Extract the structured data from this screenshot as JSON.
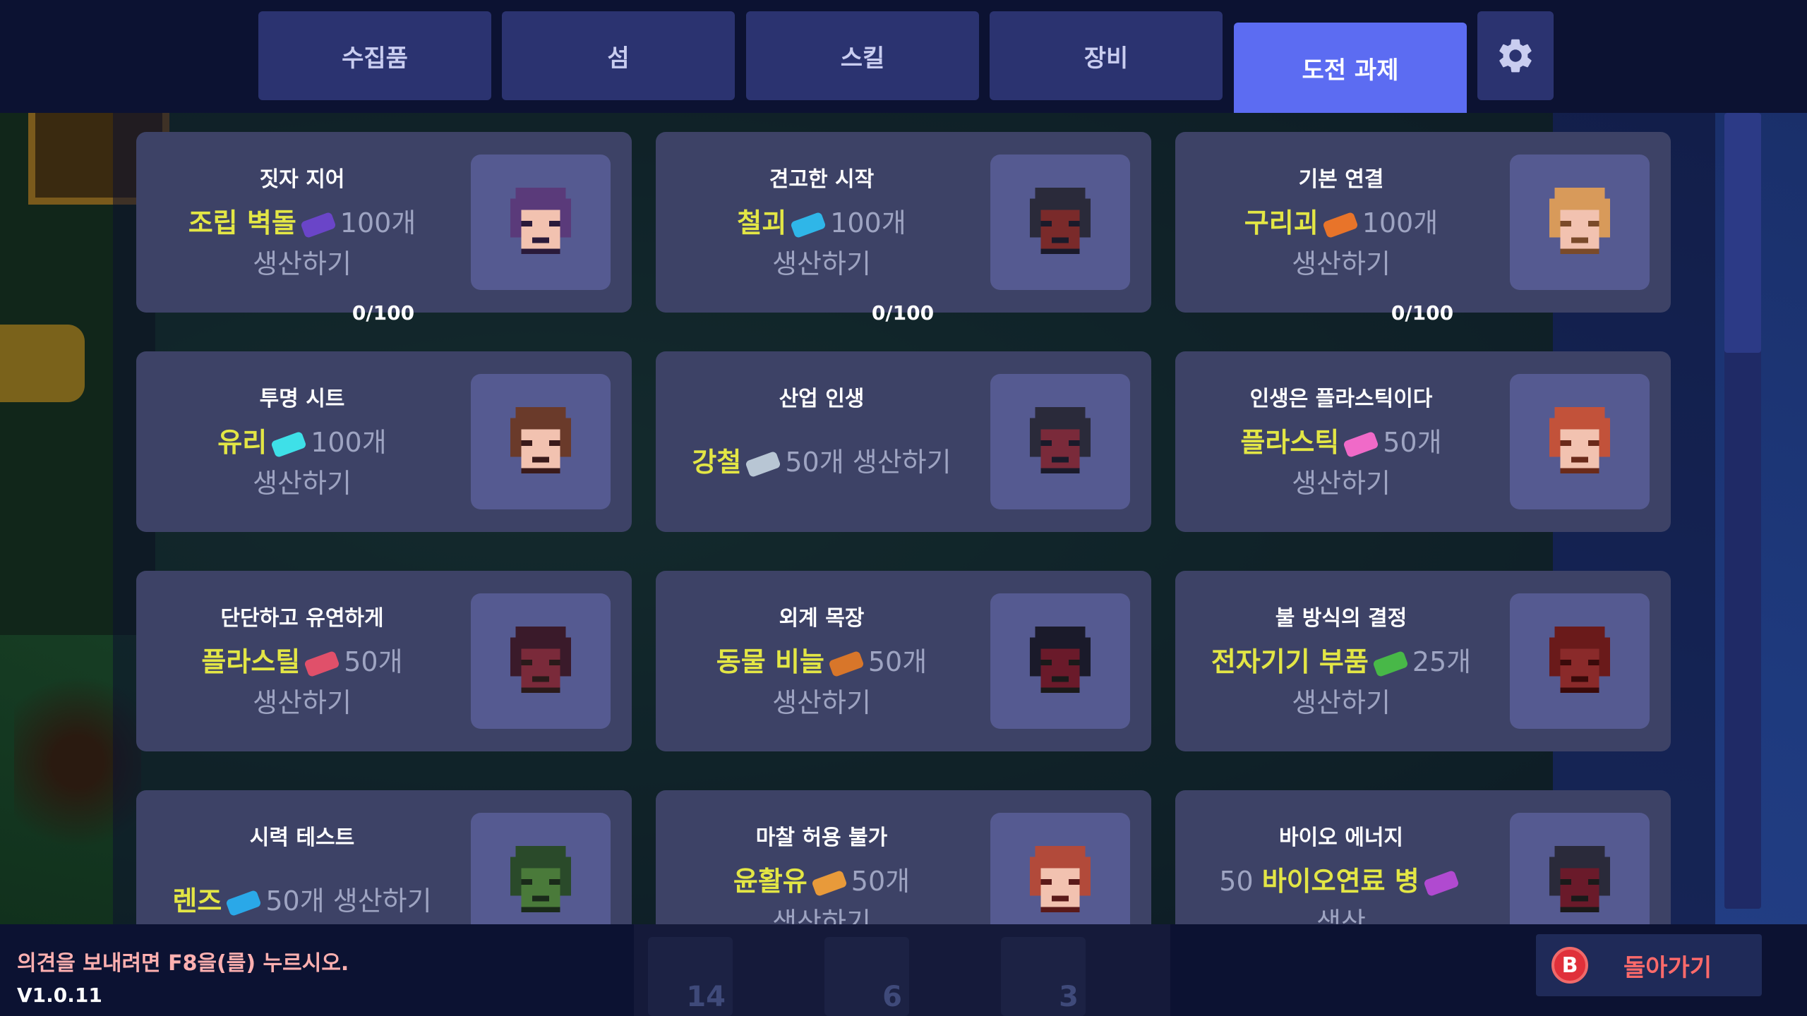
{
  "tabs": [
    {
      "label": "수집품",
      "active": false
    },
    {
      "label": "섬",
      "active": false
    },
    {
      "label": "스킬",
      "active": false
    },
    {
      "label": "장비",
      "active": false
    },
    {
      "label": "도전 과제",
      "active": true
    }
  ],
  "settings_icon": "gear-icon",
  "challenges": [
    {
      "title": "짓자 지어",
      "item": "조립 벽돌",
      "pre": "",
      "post": "100개",
      "line2": "생산하기",
      "progress": "0/100",
      "icon_color": "#6a45c8",
      "avatar": "purple-hair-face"
    },
    {
      "title": "견고한 시작",
      "item": "철괴",
      "pre": "",
      "post": "100개",
      "line2": "생산하기",
      "progress": "0/100",
      "icon_color": "#2fb6e8",
      "avatar": "dark-hair-bun-face"
    },
    {
      "title": "기본 연결",
      "item": "구리괴",
      "pre": "",
      "post": "100개",
      "line2": "생산하기",
      "progress": "0/100",
      "icon_color": "#e8742a",
      "avatar": "blonde-face"
    },
    {
      "title": "투명 시트",
      "item": "유리",
      "pre": "",
      "post": "100개",
      "line2": "생산하기",
      "progress": "",
      "icon_color": "#3ee0e8",
      "avatar": "brown-hair-face"
    },
    {
      "title": "산업 인생",
      "item": "강철",
      "pre": "",
      "post": "50개 생산하기",
      "line2": "",
      "progress": "",
      "icon_color": "#b8c6d4",
      "avatar": "dark-face"
    },
    {
      "title": "인생은 플라스틱이다",
      "item": "플라스틱",
      "pre": "",
      "post": "50개",
      "line2": "생산하기",
      "progress": "",
      "icon_color": "#f06ac8",
      "avatar": "red-hair-face"
    },
    {
      "title": "단단하고 유연하게",
      "item": "플라스틸",
      "pre": "",
      "post": "50개",
      "line2": "생산하기",
      "progress": "",
      "icon_color": "#e0506a",
      "avatar": "dark-red-face"
    },
    {
      "title": "외계 목장",
      "item": "동물 비늘",
      "pre": "",
      "post": "50개",
      "line2": "생산하기",
      "progress": "",
      "icon_color": "#d8762a",
      "avatar": "dark-curly-face"
    },
    {
      "title": "불 방식의 결정",
      "item": "전자기기 부품",
      "pre": "",
      "post": "25개",
      "line2": "생산하기",
      "progress": "",
      "icon_color": "#48b848",
      "avatar": "red-curly-face"
    },
    {
      "title": "시력 테스트",
      "item": "렌즈",
      "pre": "",
      "post": "50개 생산하기",
      "line2": "",
      "progress": "",
      "icon_color": "#2aa8e8",
      "avatar": "green-zombie-face"
    },
    {
      "title": "마찰 허용 불가",
      "item": "윤활유",
      "pre": "",
      "post": "50개",
      "line2": "생산하기",
      "progress": "",
      "icon_color": "#e89a3a",
      "avatar": "auburn-hair-face"
    },
    {
      "title": "바이오 에너지",
      "item": "바이오연료 병",
      "pre": "50",
      "post": "",
      "line2": "생산",
      "progress": "",
      "icon_color": "#b04ad0",
      "avatar": "dark-maroon-face"
    }
  ],
  "footer": {
    "feedback": "의견을 보내려면 F8을(를) 누르시오.",
    "version": "V1.0.11",
    "back_button": {
      "key": "B",
      "label": "돌아가기"
    }
  },
  "hotbar": {
    "counts": [
      "14",
      "6",
      "3"
    ]
  }
}
